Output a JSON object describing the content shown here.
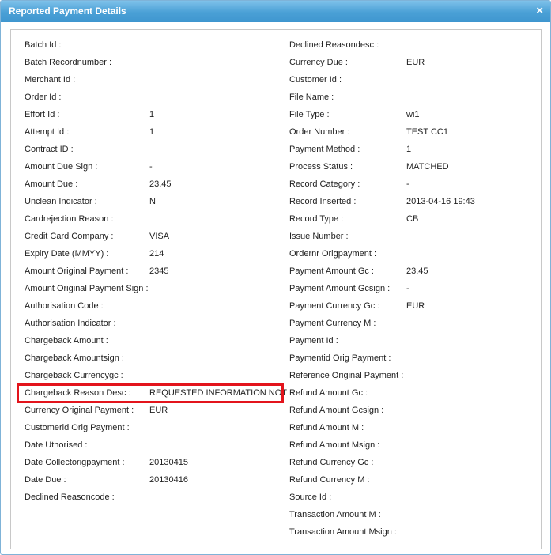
{
  "dialog": {
    "title": "Reported Payment Details",
    "close_label": "×"
  },
  "left_fields": [
    {
      "label": "Batch Id :",
      "value": ""
    },
    {
      "label": "Batch Recordnumber :",
      "value": ""
    },
    {
      "label": "Merchant Id :",
      "value": ""
    },
    {
      "label": "Order Id :",
      "value": ""
    },
    {
      "label": "Effort Id :",
      "value": "1"
    },
    {
      "label": "Attempt Id :",
      "value": "1"
    },
    {
      "label": "Contract ID :",
      "value": ""
    },
    {
      "label": "Amount Due Sign :",
      "value": "-"
    },
    {
      "label": "Amount Due :",
      "value": "23.45"
    },
    {
      "label": "Unclean Indicator :",
      "value": "N"
    },
    {
      "label": "Cardrejection Reason :",
      "value": ""
    },
    {
      "label": "Credit Card Company :",
      "value": "VISA"
    },
    {
      "label": "Expiry Date (MMYY) :",
      "value": "214"
    },
    {
      "label": "Amount Original Payment :",
      "value": "2345"
    },
    {
      "label": "Amount Original Payment Sign :",
      "value": ""
    },
    {
      "label": "Authorisation Code :",
      "value": ""
    },
    {
      "label": "Authorisation Indicator :",
      "value": ""
    },
    {
      "label": "Chargeback Amount :",
      "value": ""
    },
    {
      "label": "Chargeback Amountsign :",
      "value": ""
    },
    {
      "label": "Chargeback Currencygc :",
      "value": ""
    },
    {
      "label": "Chargeback Reason Desc :",
      "value": "REQUESTED INFORMATION NOT"
    },
    {
      "label": "Currency Original Payment :",
      "value": "EUR"
    },
    {
      "label": "Customerid Orig Payment :",
      "value": ""
    },
    {
      "label": "Date Uthorised :",
      "value": ""
    },
    {
      "label": "Date Collectorigpayment :",
      "value": "20130415"
    },
    {
      "label": "Date Due :",
      "value": "20130416"
    },
    {
      "label": "Declined Reasoncode :",
      "value": ""
    }
  ],
  "right_fields": [
    {
      "label": "Declined Reasondesc :",
      "value": ""
    },
    {
      "label": "Currency Due :",
      "value": "EUR"
    },
    {
      "label": "Customer Id :",
      "value": ""
    },
    {
      "label": "File Name :",
      "value": ""
    },
    {
      "label": "File Type :",
      "value": "wi1"
    },
    {
      "label": "Order Number :",
      "value": "TEST CC1"
    },
    {
      "label": "Payment Method :",
      "value": "1"
    },
    {
      "label": "Process Status :",
      "value": "MATCHED"
    },
    {
      "label": "Record Category :",
      "value": "-"
    },
    {
      "label": "Record Inserted :",
      "value": "2013-04-16 19:43"
    },
    {
      "label": "Record Type :",
      "value": "CB"
    },
    {
      "label": "Issue Number :",
      "value": ""
    },
    {
      "label": "Ordernr Origpayment :",
      "value": ""
    },
    {
      "label": "Payment Amount Gc :",
      "value": "23.45"
    },
    {
      "label": "Payment Amount Gcsign :",
      "value": "-"
    },
    {
      "label": "Payment Currency Gc :",
      "value": "EUR"
    },
    {
      "label": "Payment Currency M :",
      "value": ""
    },
    {
      "label": "Payment Id :",
      "value": ""
    },
    {
      "label": "Paymentid Orig Payment :",
      "value": ""
    },
    {
      "label": "Reference Original Payment :",
      "value": ""
    },
    {
      "label": "Refund Amount Gc :",
      "value": ""
    },
    {
      "label": "Refund Amount Gcsign :",
      "value": ""
    },
    {
      "label": "Refund Amount M :",
      "value": ""
    },
    {
      "label": "Refund Amount Msign :",
      "value": ""
    },
    {
      "label": "Refund Currency Gc :",
      "value": ""
    },
    {
      "label": "Refund Currency M :",
      "value": ""
    },
    {
      "label": "Source Id :",
      "value": ""
    },
    {
      "label": "Transaction Amount M :",
      "value": ""
    },
    {
      "label": "Transaction Amount Msign :",
      "value": ""
    }
  ],
  "highlight_color": "#e3141c",
  "title_bar_color": "#4aa0d6"
}
